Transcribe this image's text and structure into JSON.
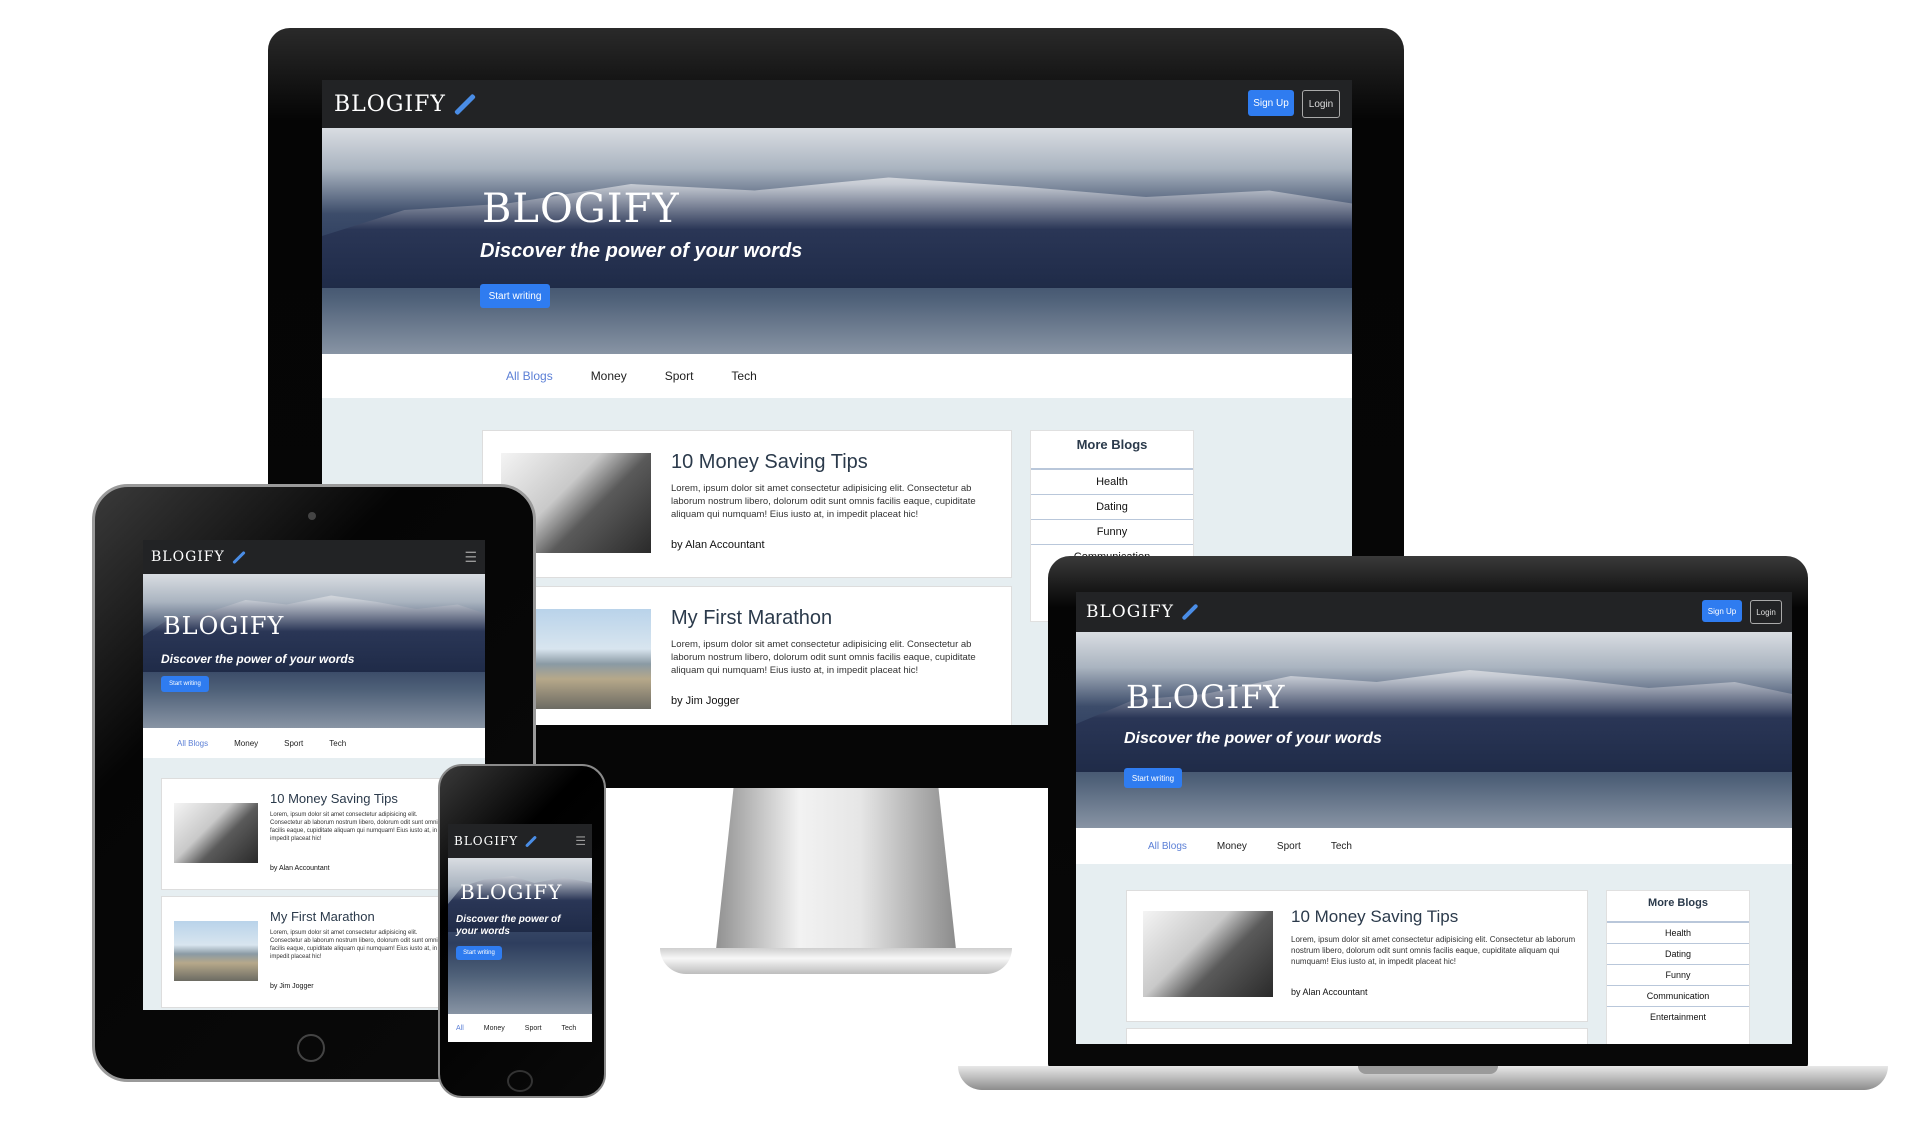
{
  "brand": {
    "name": "BLOGIFY"
  },
  "nav": {
    "signup": "Sign Up",
    "login": "Login"
  },
  "hero": {
    "title": "BLOGIFY",
    "subtitle": "Discover the power of your words",
    "cta": "Start writing"
  },
  "tabs": [
    "All Blogs",
    "Money",
    "Sport",
    "Tech"
  ],
  "phone_tabs": [
    "All",
    "Money",
    "Sport",
    "Tech"
  ],
  "posts": [
    {
      "title": "10 Money Saving Tips",
      "body": "Lorem, ipsum dolor sit amet consectetur adipisicing elit. Consectetur ab laborum nostrum libero, dolorum odit sunt omnis facilis eaque, cupiditate aliquam qui numquam! Eius iusto at, in impedit placeat hic!",
      "author": "by Alan Accountant"
    },
    {
      "title": "My First Marathon",
      "body": "Lorem, ipsum dolor sit amet consectetur adipisicing elit. Consectetur ab laborum nostrum libero, dolorum odit sunt omnis facilis eaque, cupiditate aliquam qui numquam! Eius iusto at, in impedit placeat hic!",
      "author": "by Jim Jogger"
    }
  ],
  "sidebar": {
    "title": "More Blogs",
    "items": [
      "Health",
      "Dating",
      "Funny",
      "Communication",
      "Entertainment"
    ]
  },
  "colors": {
    "accent": "#2f7cf0",
    "nav_bg": "#222325",
    "active_tab": "#5b7fd6"
  }
}
